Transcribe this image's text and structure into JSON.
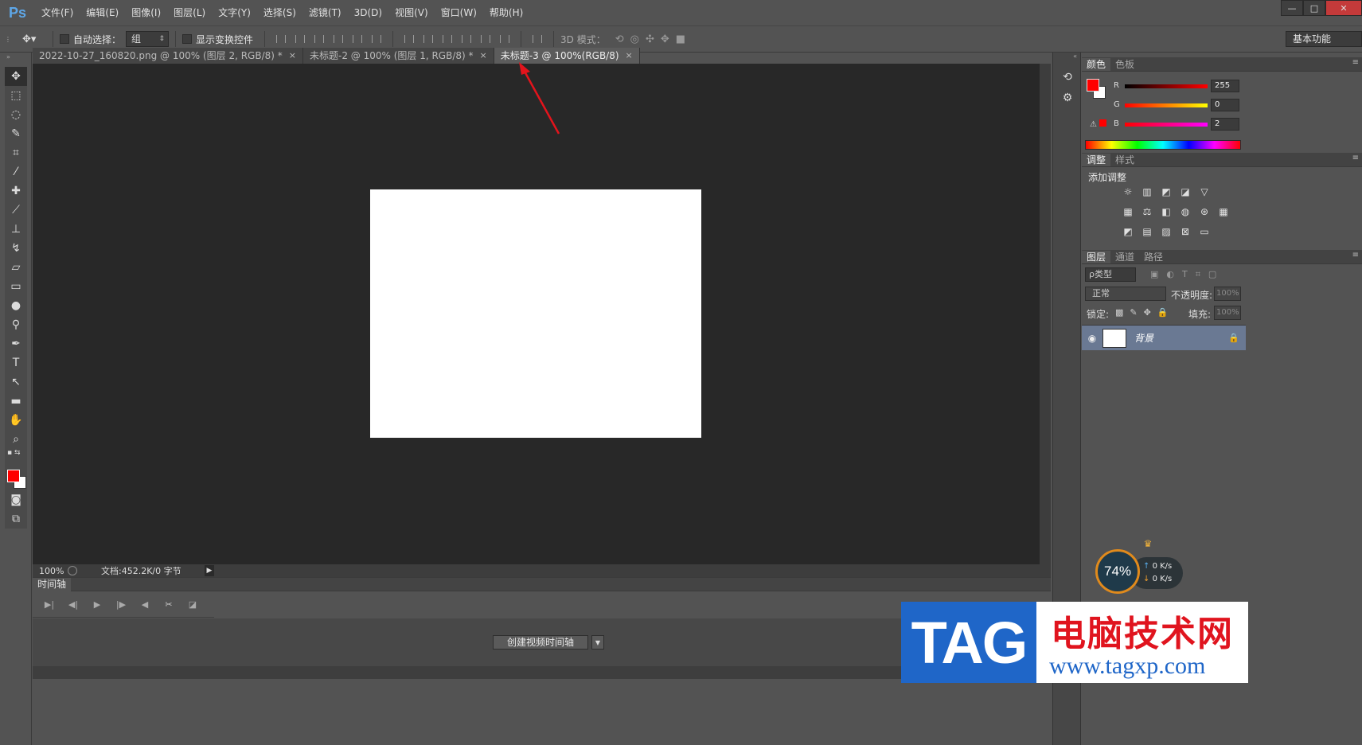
{
  "app": {
    "logo": "Ps",
    "menu": [
      "文件(F)",
      "编辑(E)",
      "图像(I)",
      "图层(L)",
      "文字(Y)",
      "选择(S)",
      "滤镜(T)",
      "3D(D)",
      "视图(V)",
      "窗口(W)",
      "帮助(H)"
    ],
    "window_controls": {
      "minimize": "—",
      "maximize": "□",
      "close": "✕"
    }
  },
  "options_bar": {
    "auto_select_label": "自动选择：",
    "auto_select_value": "组",
    "show_transform_label": "显示变换控件",
    "mode_3d_label": "3D 模式：",
    "workspace": "基本功能"
  },
  "tabs": [
    {
      "label": "2022-10-27_160820.png @ 100% (图层 2, RGB/8) *",
      "close": "×",
      "active": false
    },
    {
      "label": "未标题-2 @ 100% (图层 1, RGB/8) *",
      "close": "×",
      "active": false
    },
    {
      "label": "未标题-3 @ 100%(RGB/8)",
      "close": "×",
      "active": true
    }
  ],
  "status": {
    "zoom": "100%",
    "doc_info": "文档:452.2K/0 字节",
    "arrow": "▶"
  },
  "timeline": {
    "tab_label": "时间轴",
    "create_button": "创建视频时间轴",
    "create_arrow": "▼"
  },
  "color_panel": {
    "tabs": [
      "颜色",
      "色板"
    ],
    "fg_color": "#ff0000",
    "channels": [
      {
        "label": "R",
        "value": "255"
      },
      {
        "label": "G",
        "value": "0"
      },
      {
        "label": "B",
        "value": "2"
      }
    ]
  },
  "adjust_panel": {
    "tabs": [
      "调整",
      "样式"
    ],
    "title": "添加调整"
  },
  "layers_panel": {
    "tabs": [
      "图层",
      "通道",
      "路径"
    ],
    "filter_label": "ρ类型",
    "blend_mode": "正常",
    "opacity_label": "不透明度:",
    "opacity_value": "100%",
    "lock_label": "锁定:",
    "fill_label": "填充:",
    "fill_value": "100%",
    "layers": [
      {
        "name": "背景"
      }
    ]
  },
  "net_widget": {
    "percent": "74%",
    "up": "0 K/s",
    "down": "0 K/s"
  },
  "watermark": {
    "badge": "TAG",
    "title": "电脑技术网",
    "url": "www.tagxp.com"
  },
  "colors": {
    "accent_red": "#ff0000",
    "layer_selected": "#6a7993",
    "canvas_bg": "#282828"
  }
}
